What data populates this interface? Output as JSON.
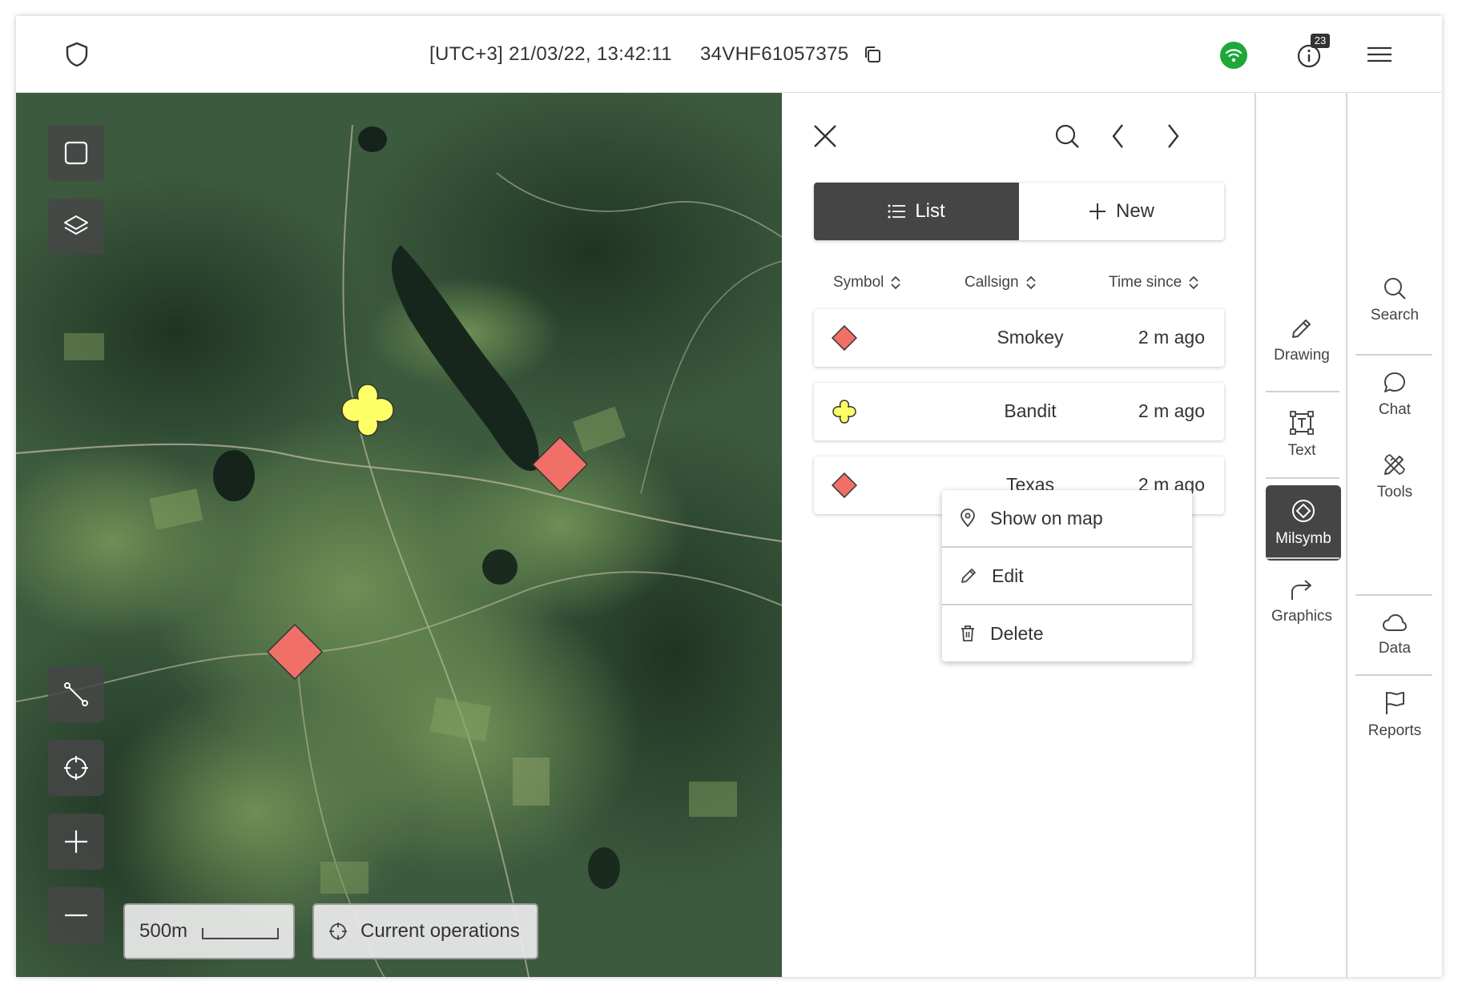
{
  "topbar": {
    "datetime": "[UTC+3] 21/03/22, 13:42:11",
    "grid_reference": "34VHF61057375",
    "notification_count": "23",
    "status_color": "#1fa83a"
  },
  "map": {
    "scale_label": "500m",
    "operations_label": "Current operations",
    "markers": [
      {
        "type": "diamond",
        "color": "#f07068"
      },
      {
        "type": "clover",
        "color": "#ffff66"
      },
      {
        "type": "diamond",
        "color": "#f07068"
      }
    ]
  },
  "panel": {
    "tabs": {
      "list_label": "List",
      "new_label": "New"
    },
    "columns": {
      "symbol": "Symbol",
      "callsign": "Callsign",
      "time_since": "Time since"
    },
    "rows": [
      {
        "symbol": "diamond-red",
        "callsign": "Smokey",
        "time": "2 m ago"
      },
      {
        "symbol": "clover-yellow",
        "callsign": "Bandit",
        "time": "2 m ago"
      },
      {
        "symbol": "diamond-red",
        "callsign": "Texas",
        "time": "2 m ago"
      }
    ],
    "context_menu": {
      "show_on_map": "Show on map",
      "edit": "Edit",
      "delete": "Delete"
    }
  },
  "rail_left": {
    "items": [
      {
        "label": "Drawing",
        "icon": "pencil-icon"
      },
      {
        "label": "Text",
        "icon": "text-box-icon"
      },
      {
        "label": "Milsymb",
        "icon": "milsymb-icon",
        "active": true
      },
      {
        "label": "Graphics",
        "icon": "share-arrow-icon"
      }
    ]
  },
  "rail_right": {
    "items": [
      {
        "label": "Search",
        "icon": "search-icon"
      },
      {
        "label": "Chat",
        "icon": "chat-icon"
      },
      {
        "label": "Tools",
        "icon": "tools-icon"
      },
      {
        "label": "Data",
        "icon": "cloud-icon"
      },
      {
        "label": "Reports",
        "icon": "flag-icon"
      }
    ]
  },
  "colors": {
    "accent_dark": "#454545",
    "hostile": "#f07068",
    "unknown": "#ffff66"
  }
}
